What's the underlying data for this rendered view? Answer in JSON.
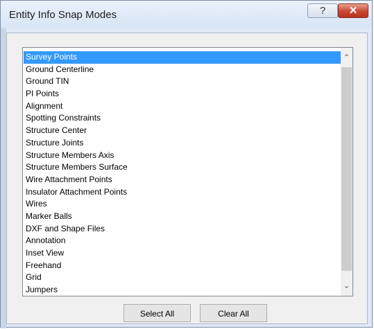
{
  "window": {
    "title": "Entity Info Snap Modes",
    "help_label": "?",
    "close_label": "✕"
  },
  "list": {
    "selected_index": 0,
    "items": [
      "Survey Points",
      "Ground Centerline",
      "Ground TIN",
      "PI Points",
      "Alignment",
      "Spotting Constraints",
      "Structure Center",
      "Structure Joints",
      "Structure Members Axis",
      "Structure Members Surface",
      "Wire Attachment Points",
      "Insulator Attachment Points",
      "Wires",
      "Marker Balls",
      "DXF and Shape Files",
      "Annotation",
      "Inset View",
      "Freehand",
      "Grid",
      "Jumpers"
    ]
  },
  "scrollbar": {
    "up_icon": "⌃",
    "down_icon": "⌄"
  },
  "buttons": {
    "select_all": "Select All",
    "clear_all": "Clear All"
  },
  "colors": {
    "selection": "#3399ff",
    "close_button": "#c94630"
  }
}
